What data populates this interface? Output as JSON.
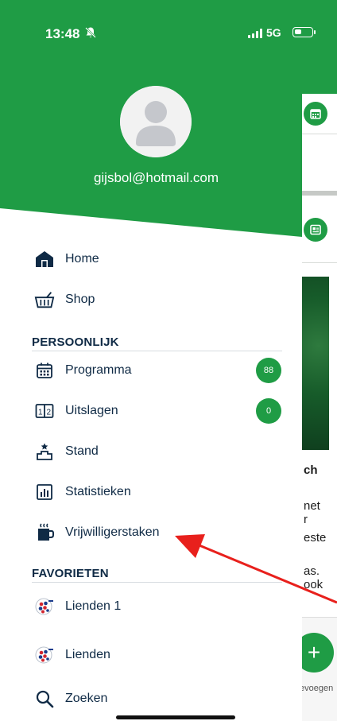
{
  "status_bar": {
    "time": "13:48",
    "network": "5G"
  },
  "account": {
    "email": "gijsbol@hotmail.com"
  },
  "menu": {
    "top_items": [
      {
        "label": "Home",
        "icon": "home-icon"
      },
      {
        "label": "Shop",
        "icon": "basket-icon"
      }
    ],
    "section_personal": "PERSOONLIJK",
    "personal_items": [
      {
        "label": "Programma",
        "icon": "calendar-icon",
        "badge": "88"
      },
      {
        "label": "Uitslagen",
        "icon": "scoreboard-icon",
        "badge": "0"
      },
      {
        "label": "Stand",
        "icon": "podium-icon"
      },
      {
        "label": "Statistieken",
        "icon": "bar-chart-icon"
      },
      {
        "label": "Vrijwilligerstaken",
        "icon": "mug-icon"
      }
    ],
    "section_favorites": "FAVORIETEN",
    "favorite_items": [
      {
        "label": "Lienden 1",
        "icon": "club-logo-icon"
      },
      {
        "label": "Lienden",
        "icon": "club-logo-icon"
      }
    ],
    "search": {
      "label": "Zoeken",
      "icon": "search-icon"
    }
  },
  "background_app": {
    "text_fragments": [
      "ch",
      "net",
      "r",
      "este",
      "as.",
      "ook"
    ],
    "fab_symbol": "+",
    "fab_label": "evoegen"
  },
  "colors": {
    "brand_green": "#1f9c45",
    "text_navy": "#0f2a45",
    "annotation_arrow": "#e8201c"
  }
}
